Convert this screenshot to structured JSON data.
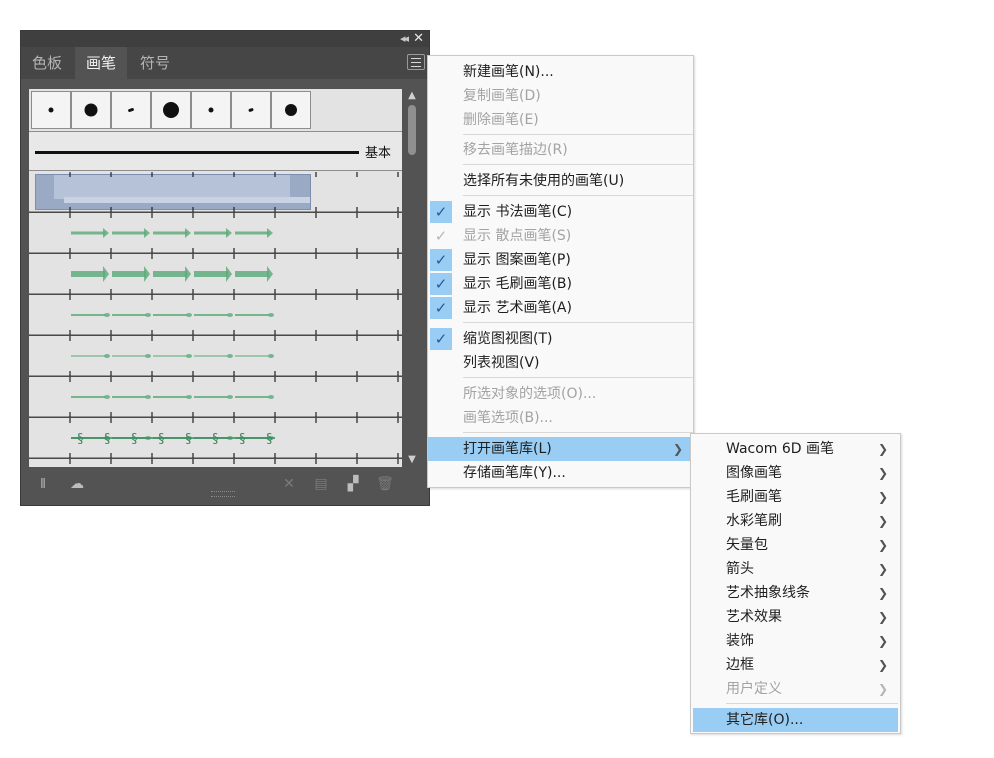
{
  "panel": {
    "tabs": [
      "色板",
      "画笔",
      "符号"
    ],
    "active_tab": "画笔",
    "basic_brush_label": "基本",
    "close_glyph": "✕",
    "collapse_glyph": "◂◂"
  },
  "menu": {
    "items": [
      {
        "label": "新建画笔(N)...",
        "disabled": false
      },
      {
        "label": "复制画笔(D)",
        "disabled": true
      },
      {
        "label": "删除画笔(E)",
        "disabled": true
      },
      {
        "label": "移去画笔描边(R)",
        "disabled": true
      },
      {
        "label": "选择所有未使用的画笔(U)",
        "disabled": false
      },
      {
        "label": "显示 书法画笔(C)",
        "checked": true
      },
      {
        "label": "显示 散点画笔(S)",
        "checked": true,
        "disabled": true
      },
      {
        "label": "显示 图案画笔(P)",
        "checked": true
      },
      {
        "label": "显示 毛刷画笔(B)",
        "checked": true
      },
      {
        "label": "显示 艺术画笔(A)",
        "checked": true
      },
      {
        "label": "缩览图视图(T)",
        "checked": true
      },
      {
        "label": "列表视图(V)",
        "disabled": false
      },
      {
        "label": "所选对象的选项(O)...",
        "disabled": true
      },
      {
        "label": "画笔选项(B)...",
        "disabled": true
      },
      {
        "label": "打开画笔库(L)",
        "submenu": true,
        "highlighted": true
      },
      {
        "label": "存储画笔库(Y)...",
        "disabled": false
      }
    ]
  },
  "submenu": {
    "items": [
      {
        "label": "Wacom 6D 画笔",
        "arrow": true
      },
      {
        "label": "图像画笔",
        "arrow": true
      },
      {
        "label": "毛刷画笔",
        "arrow": true
      },
      {
        "label": "水彩笔刷",
        "arrow": true
      },
      {
        "label": "矢量包",
        "arrow": true
      },
      {
        "label": "箭头",
        "arrow": true
      },
      {
        "label": "艺术抽象线条",
        "arrow": true
      },
      {
        "label": "艺术效果",
        "arrow": true
      },
      {
        "label": "装饰",
        "arrow": true
      },
      {
        "label": "边框",
        "arrow": true
      },
      {
        "label": "用户定义",
        "arrow": true,
        "disabled": true
      },
      {
        "label": "其它库(O)...",
        "highlighted": true
      }
    ]
  },
  "colors": {
    "highlight": "#99cdf3",
    "check": "#1f5e99",
    "brush_green": "#5aaa78"
  }
}
